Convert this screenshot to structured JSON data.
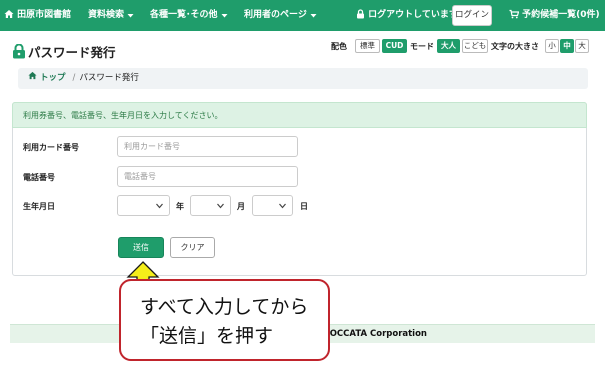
{
  "nav": {
    "library": "田原市図書館",
    "search": "資料検索",
    "lists": "各種一覧･その他",
    "user_page": "利用者のページ",
    "logout_status": "ログアウトしています",
    "login": "ログイン",
    "reserve_cart": "予約候補一覧(0件)"
  },
  "page": {
    "title": "パスワード発行"
  },
  "settings": {
    "color_label": "配色",
    "standard": "標準",
    "cud": "CUD",
    "mode_label": "モード",
    "adult": "大人",
    "child": "こども",
    "fontsize_label": "文字の大きさ",
    "small": "小",
    "medium": "中",
    "large": "大"
  },
  "breadcrumb": {
    "top": "トップ",
    "current": "パスワード発行"
  },
  "form": {
    "notice": "利用券番号、電話番号、生年月日を入力してください。",
    "card_label": "利用カード番号",
    "card_placeholder": "利用カード番号",
    "phone_label": "電話番号",
    "phone_placeholder": "電話番号",
    "birth_label": "生年月日",
    "year_unit": "年",
    "month_unit": "月",
    "day_unit": "日",
    "submit": "送信",
    "clear": "クリア"
  },
  "footer": {
    "credit": "OCCATA Corporation"
  },
  "annotation": {
    "line1": "すべて入力してから",
    "line2": "「送信」を押す"
  },
  "colors": {
    "brand": "#1f9d6b",
    "callout_border": "#c0242c",
    "arrow": "#f5ee1a"
  }
}
